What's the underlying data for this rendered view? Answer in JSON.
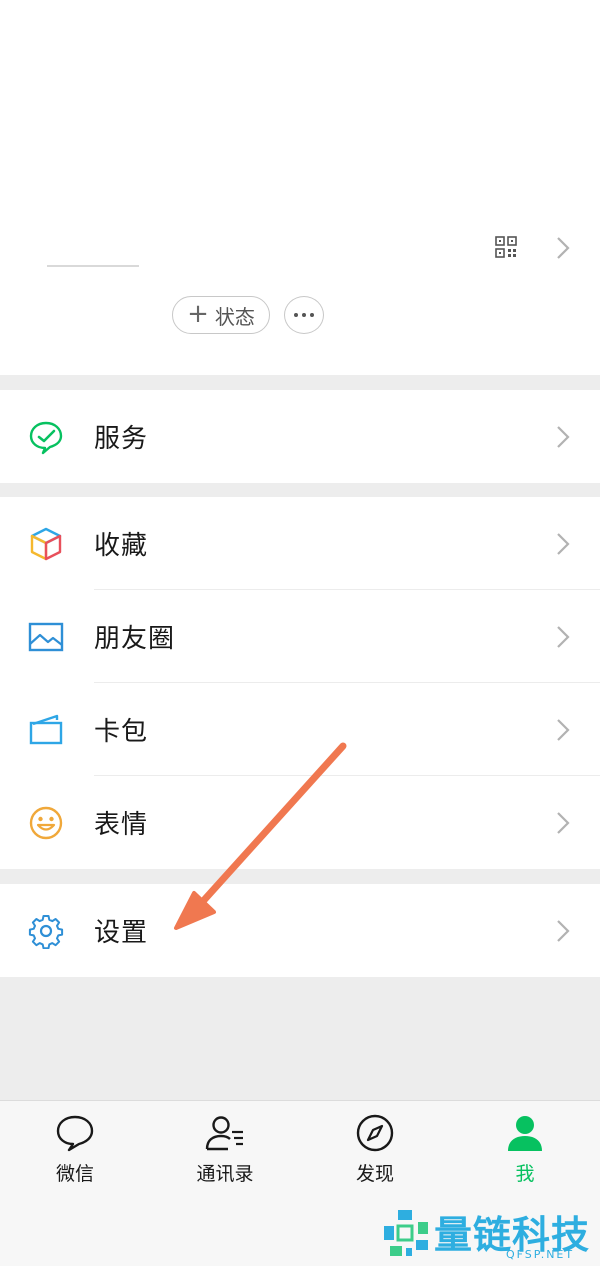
{
  "profile": {
    "status_label": "状态"
  },
  "menu": {
    "services": {
      "label": "服务"
    },
    "favorites": {
      "label": "收藏"
    },
    "moments": {
      "label": "朋友圈"
    },
    "cards": {
      "label": "卡包"
    },
    "stickers": {
      "label": "表情"
    },
    "settings": {
      "label": "设置"
    }
  },
  "tabs": [
    {
      "label": "微信",
      "icon": "chat-bubble-icon",
      "active": false
    },
    {
      "label": "通讯录",
      "icon": "contacts-icon",
      "active": false
    },
    {
      "label": "发现",
      "icon": "compass-icon",
      "active": false
    },
    {
      "label": "我",
      "icon": "person-icon",
      "active": true
    }
  ],
  "colors": {
    "accent": "#07c160",
    "annotation_arrow": "#f07850",
    "watermark": "#2eaee0"
  },
  "watermark": {
    "name": "量链科技",
    "url": "QFSP.NET"
  }
}
